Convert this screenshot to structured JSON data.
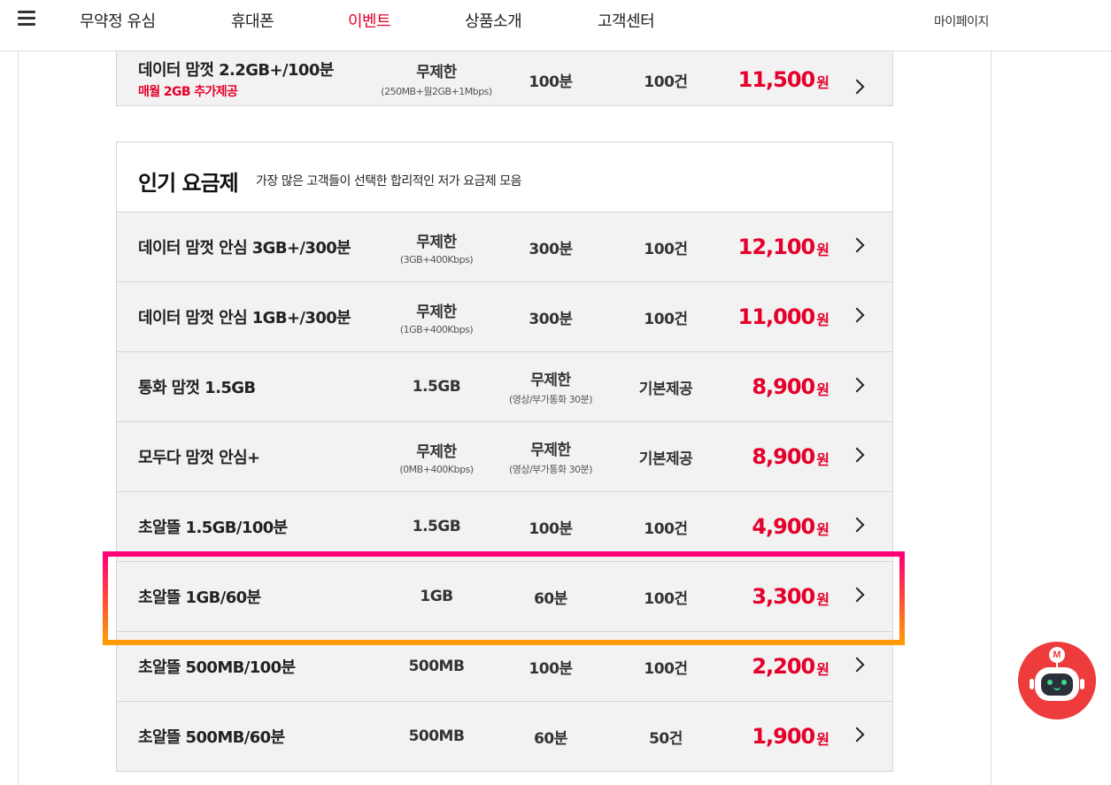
{
  "nav": {
    "items": [
      "무약정 유심",
      "휴대폰",
      "이벤트",
      "상품소개",
      "고객센터"
    ],
    "active_index": 2,
    "mypage": "마이페이지"
  },
  "top_plan": {
    "name": "데이터 맘껏 2.2GB+/100분",
    "promo": "매월 2GB 추가제공",
    "data_main": "무제한",
    "data_sub": "(250MB+월2GB+1Mbps)",
    "voice": "100분",
    "sms": "100건",
    "price": "11,500",
    "currency": "원"
  },
  "section": {
    "title": "인기 요금제",
    "description": "가장 많은 고객들이 선택한 합리적인 저가 요금제 모음"
  },
  "plans": [
    {
      "name": "데이터 맘껏 안심 3GB+/300분",
      "data_main": "무제한",
      "data_sub": "(3GB+400Kbps)",
      "voice_main": "300분",
      "voice_sub": "",
      "sms": "100건",
      "price": "12,100",
      "currency": "원"
    },
    {
      "name": "데이터 맘껏 안심 1GB+/300분",
      "data_main": "무제한",
      "data_sub": "(1GB+400Kbps)",
      "voice_main": "300분",
      "voice_sub": "",
      "sms": "100건",
      "price": "11,000",
      "currency": "원"
    },
    {
      "name": "통화 맘껏 1.5GB",
      "data_main": "1.5GB",
      "data_sub": "",
      "voice_main": "무제한",
      "voice_sub": "(영상/부가통화 30분)",
      "sms": "기본제공",
      "price": "8,900",
      "currency": "원"
    },
    {
      "name": "모두다 맘껏 안심+",
      "data_main": "무제한",
      "data_sub": "(0MB+400Kbps)",
      "voice_main": "무제한",
      "voice_sub": "(영상/부가통화 30분)",
      "sms": "기본제공",
      "price": "8,900",
      "currency": "원"
    },
    {
      "name": "초알뜰 1.5GB/100분",
      "data_main": "1.5GB",
      "data_sub": "",
      "voice_main": "100분",
      "voice_sub": "",
      "sms": "100건",
      "price": "4,900",
      "currency": "원"
    },
    {
      "name": "초알뜰 1GB/60분",
      "data_main": "1GB",
      "data_sub": "",
      "voice_main": "60분",
      "voice_sub": "",
      "sms": "100건",
      "price": "3,300",
      "currency": "원"
    },
    {
      "name": "초알뜰 500MB/100분",
      "data_main": "500MB",
      "data_sub": "",
      "voice_main": "100분",
      "voice_sub": "",
      "sms": "100건",
      "price": "2,200",
      "currency": "원"
    },
    {
      "name": "초알뜰 500MB/60분",
      "data_main": "500MB",
      "data_sub": "",
      "voice_main": "60분",
      "voice_sub": "",
      "sms": "50건",
      "price": "1,900",
      "currency": "원"
    }
  ],
  "highlighted_plan_index": 5,
  "chatbot": {
    "badge": "M",
    "icon": "chatbot-robot-icon"
  },
  "colors": {
    "accent": "#e4002b",
    "row_bg": "#f2f2f2",
    "highlight_top": "#ff0077",
    "highlight_bottom": "#ff9a00",
    "chatbot": "#ee3b3b"
  }
}
